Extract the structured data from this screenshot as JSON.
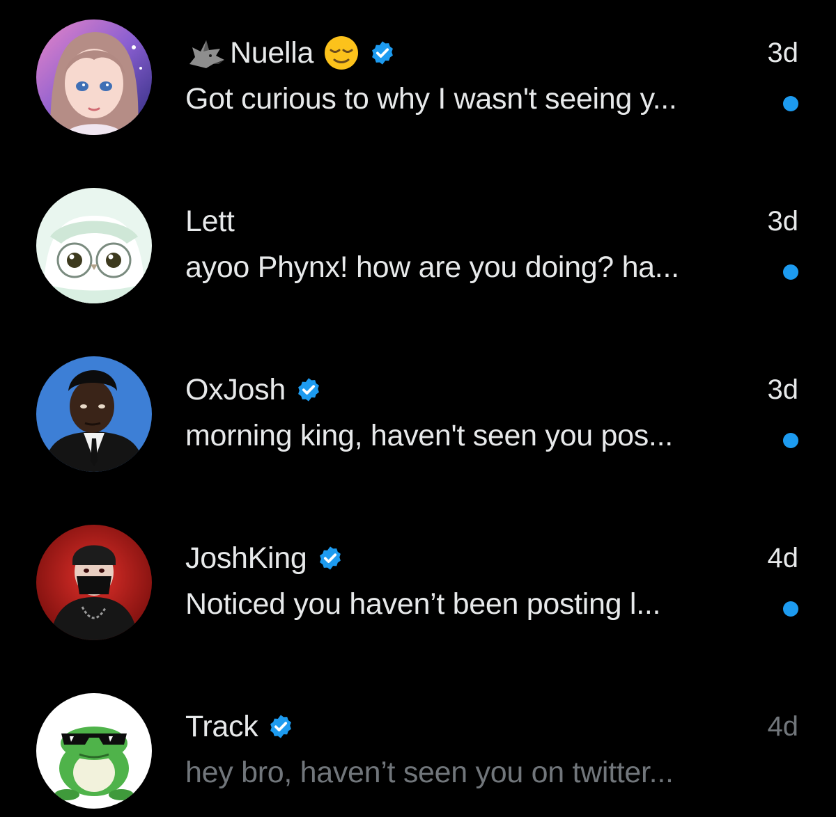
{
  "colors": {
    "background": "#000000",
    "primary_text": "#e7e9ea",
    "secondary_text": "#71767b",
    "accent_blue": "#1d9bf0"
  },
  "conversations": [
    {
      "name": "Nuella",
      "prefix_icon": "wolf-head-icon",
      "suffix_icon": "relieved-face-emoji-icon",
      "verified": true,
      "time": "3d",
      "preview": "Got curious to why I wasn't seeing y...",
      "unread": true,
      "avatar_icon": "anime-girl-avatar"
    },
    {
      "name": "Lett",
      "verified": false,
      "time": "3d",
      "preview": "ayoo Phynx! how are you doing? ha...",
      "unread": true,
      "avatar_icon": "owl-with-glasses-avatar"
    },
    {
      "name": "OxJosh",
      "verified": true,
      "time": "3d",
      "preview": "morning king, haven't seen you pos...",
      "unread": true,
      "avatar_icon": "man-in-suit-avatar"
    },
    {
      "name": "JoshKing",
      "verified": true,
      "time": "4d",
      "preview": "Noticed you haven’t been posting l...",
      "unread": true,
      "avatar_icon": "masked-hoodie-avatar"
    },
    {
      "name": "Track",
      "verified": true,
      "time": "4d",
      "preview": "hey bro, haven’t seen you on twitter...",
      "unread": false,
      "avatar_icon": "frog-with-sunglasses-avatar"
    }
  ]
}
